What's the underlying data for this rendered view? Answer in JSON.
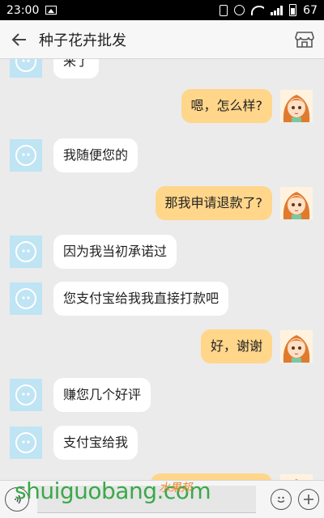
{
  "status_bar": {
    "time": "23:00",
    "battery": "67"
  },
  "header": {
    "title": "种子花卉批发"
  },
  "messages": [
    {
      "side": "left",
      "text": "来了"
    },
    {
      "side": "right",
      "text": "嗯，怎么样?"
    },
    {
      "side": "left",
      "text": "我随便您的"
    },
    {
      "side": "right",
      "text": "那我申请退款了?"
    },
    {
      "side": "left",
      "text": "因为我当初承诺过"
    },
    {
      "side": "left",
      "text": "您支付宝给我我直接打款吧"
    },
    {
      "side": "right",
      "text": "好，谢谢"
    },
    {
      "side": "left",
      "text": "赚您几个好评"
    },
    {
      "side": "left",
      "text": "支付宝给我"
    },
    {
      "side": "right",
      "text": ""
    }
  ],
  "watermark": {
    "text": "shuiguobang.com",
    "cn": "水果邦"
  },
  "icons": {
    "back": "arrow-left-icon",
    "store": "store-icon",
    "voice": "voice-icon",
    "emoji": "emoji-icon",
    "plus": "plus-icon"
  }
}
